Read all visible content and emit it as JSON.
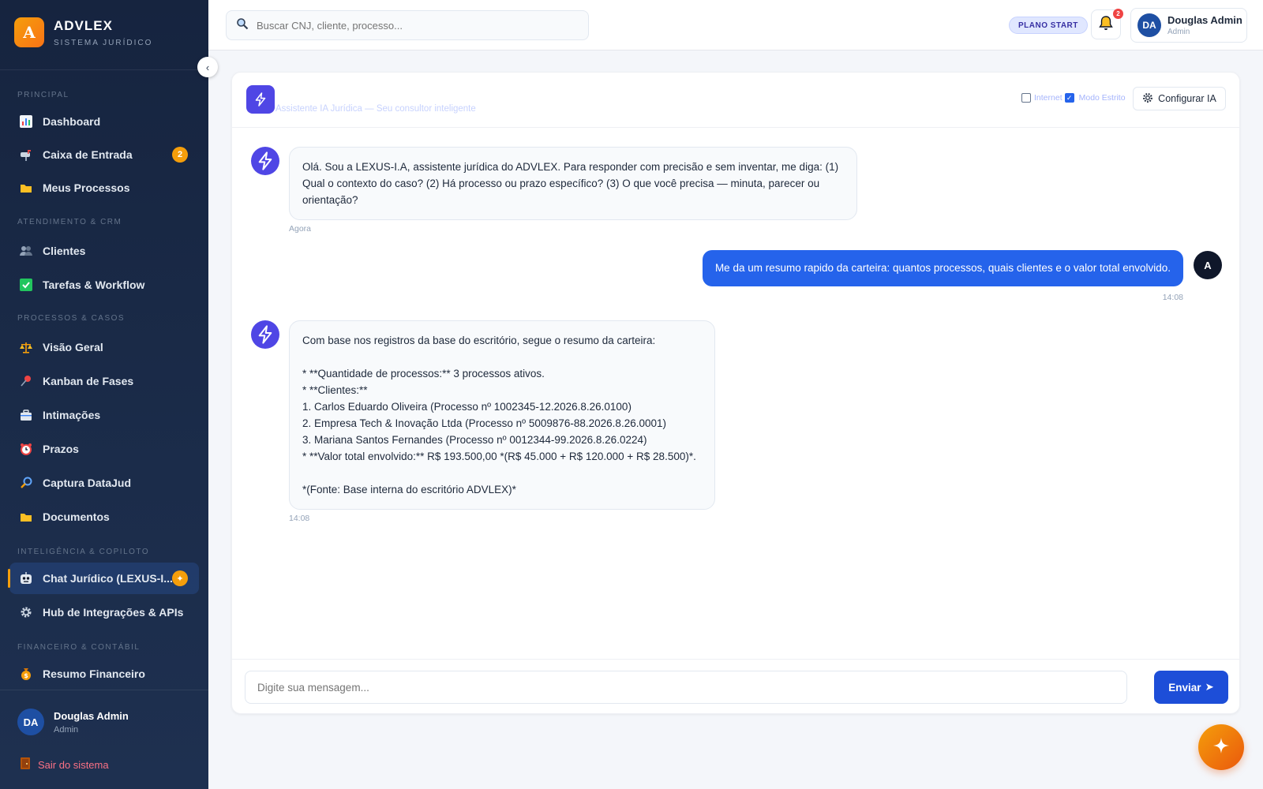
{
  "brand": {
    "logo_letter": "A",
    "name": "ADVLEX",
    "subtitle": "SISTEMA JURÍDICO",
    "accent": "#f59e0b"
  },
  "sidebar": {
    "collapse_glyph": "‹",
    "sections": [
      {
        "label": "PRINCIPAL"
      },
      {
        "label": "ATENDIMENTO & CRM"
      },
      {
        "label": "PROCESSOS & CASOS"
      },
      {
        "label": "INTELIGÊNCIA & COPILOTO"
      },
      {
        "label": "FINANCEIRO & CONTÁBIL"
      }
    ],
    "items": [
      {
        "label": "Dashboard",
        "icon": "bar-chart-icon"
      },
      {
        "label": "Caixa de Entrada",
        "icon": "mailbox-icon",
        "badge": "2"
      },
      {
        "label": "Meus Processos",
        "icon": "folder-icon"
      },
      {
        "label": "Clientes",
        "icon": "users-icon"
      },
      {
        "label": "Tarefas & Workflow",
        "icon": "checkbox-icon"
      },
      {
        "label": "Visão Geral",
        "icon": "scales-icon"
      },
      {
        "label": "Kanban de Fases",
        "icon": "pushpin-icon"
      },
      {
        "label": "Intimações",
        "icon": "briefcase-icon"
      },
      {
        "label": "Prazos",
        "icon": "alarm-clock-icon"
      },
      {
        "label": "Captura DataJud",
        "icon": "magnifier-icon"
      },
      {
        "label": "Documentos",
        "icon": "folder-icon"
      },
      {
        "label": "Chat Jurídico (LEXUS-I...",
        "icon": "robot-icon",
        "badge": "✦",
        "active": true
      },
      {
        "label": "Hub de Integrações & APIs",
        "icon": "gear-icon"
      },
      {
        "label": "Resumo Financeiro",
        "icon": "money-bag-icon"
      }
    ],
    "user": {
      "initials": "DA",
      "name": "Douglas Admin",
      "role": "Admin"
    },
    "logout_label": "Sair do sistema"
  },
  "topbar": {
    "search_placeholder": "Buscar CNJ, cliente, processo...",
    "plan_label": "PLANO START",
    "notification_count": "2",
    "user": {
      "initials": "DA",
      "name": "Douglas Admin",
      "role": "Admin"
    }
  },
  "chat": {
    "header_subtitle": "Assistente IA Jurídica — Seu consultor inteligente",
    "toggle_internet": {
      "label": "Internet",
      "checked": false
    },
    "toggle_strict": {
      "label": "Modo Estrito",
      "checked": true
    },
    "config_label": "Configurar IA",
    "messages": [
      {
        "role": "assistant",
        "text": "Olá. Sou a LEXUS-I.A, assistente jurídica do ADVLEX. Para responder com precisão e sem inventar, me diga: (1) Qual o contexto do caso? (2) Há processo ou prazo específico? (3) O que você precisa — minuta, parecer ou orientação?",
        "time": "Agora"
      },
      {
        "role": "user",
        "avatar": "A",
        "text": "Me da um resumo rapido da carteira: quantos processos, quais clientes e o valor total envolvido.",
        "time": "14:08"
      },
      {
        "role": "assistant",
        "text": "Com base nos registros da base do escritório, segue o resumo da carteira:\n\n* **Quantidade de processos:** 3 processos ativos.\n* **Clientes:**\n   1. Carlos Eduardo Oliveira (Processo nº 1002345-12.2026.8.26.0100)\n   2. Empresa Tech & Inovação Ltda (Processo nº 5009876-88.2026.8.26.0001)\n   3. Mariana Santos Fernandes (Processo nº 0012344-99.2026.8.26.0224)\n* **Valor total envolvido:** R$ 193.500,00 *(R$ 45.000 + R$ 120.000 + R$ 28.500)*.\n\n*(Fonte: Base interna do escritório ADVLEX)*",
        "time": "14:08"
      }
    ],
    "composer_placeholder": "Digite sua mensagem...",
    "send_label": "Enviar",
    "send_glyph": "➤"
  },
  "colors": {
    "primary": "#2563eb",
    "indigo": "#4f46e5",
    "sidebar_bg": "#16243f",
    "accent": "#f59e0b"
  }
}
